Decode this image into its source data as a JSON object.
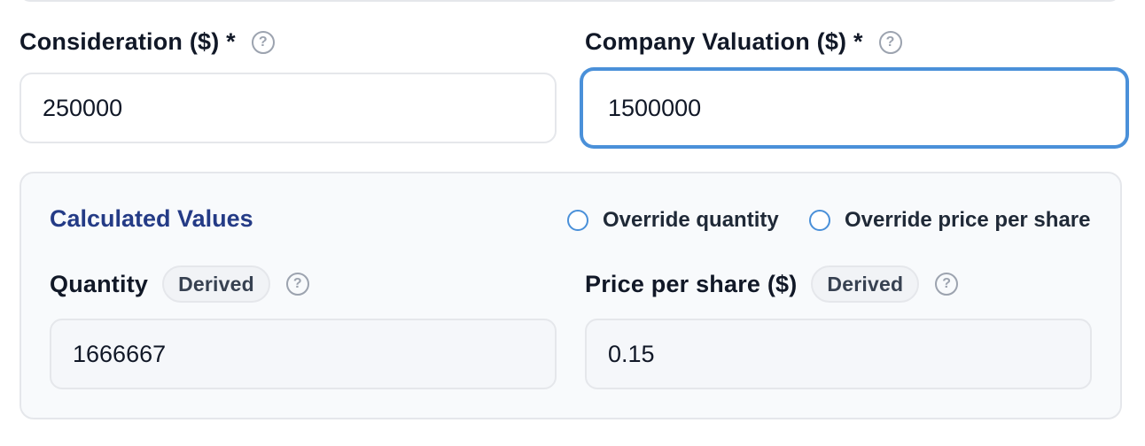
{
  "consideration": {
    "label": "Consideration ($) *",
    "value": "250000"
  },
  "valuation": {
    "label": "Company Valuation ($) *",
    "value": "1500000"
  },
  "calculated": {
    "title": "Calculated Values",
    "override_quantity": "Override quantity",
    "override_price": "Override price per share",
    "quantity": {
      "label": "Quantity",
      "badge": "Derived",
      "value": "1666667"
    },
    "price": {
      "label": "Price per share ($)",
      "badge": "Derived",
      "value": "0.15"
    }
  },
  "icons": {
    "help": "help-circle-icon",
    "help_glyph": "?"
  },
  "colors": {
    "accent": "#4a90d9",
    "title": "#243b86",
    "muted": "#9ca3af"
  }
}
